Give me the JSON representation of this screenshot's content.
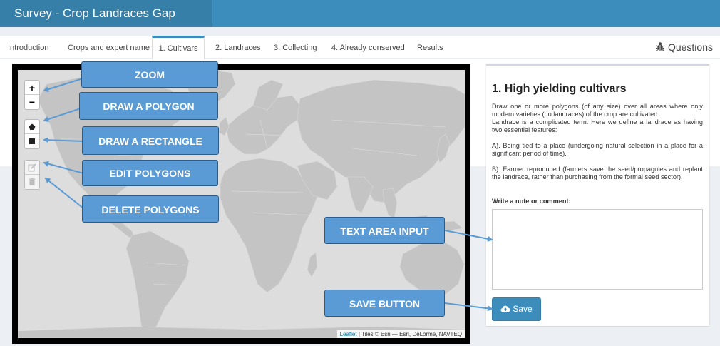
{
  "app": {
    "title": "Survey - Crop Landraces Gap Analysis"
  },
  "tabs": [
    {
      "label": "Introduction"
    },
    {
      "label": "Crops and expert name"
    },
    {
      "label": "1. Cultivars"
    },
    {
      "label": "2. Landraces"
    },
    {
      "label": "3. Collecting"
    },
    {
      "label": "4. Already conserved"
    },
    {
      "label": "Results"
    }
  ],
  "active_tab": "1. Cultivars",
  "questions": {
    "label": "Questions",
    "icon": "bug-icon"
  },
  "map": {
    "controls": {
      "zoom_in": "+",
      "zoom_out": "−",
      "draw_polygon_icon": "pentagon-icon",
      "draw_rectangle_icon": "square-icon",
      "edit_icon": "edit-icon",
      "delete_icon": "trash-icon"
    },
    "attribution_link": "Leaflet",
    "attribution_text": " | Tiles © Esri — Esri, DeLorme, NAVTEQ"
  },
  "callouts": {
    "zoom": "ZOOM",
    "draw_polygon": "DRAW A POLYGON",
    "draw_rectangle": "DRAW A RECTANGLE",
    "edit_polygons": "EDIT POLYGONS",
    "delete_polygons": "DELETE POLYGONS",
    "text_area": "TEXT AREA INPUT",
    "save_button": "SAVE BUTTON"
  },
  "panel": {
    "title": "1. High yielding cultivars",
    "intro": "Draw one or more polygons (of any size) over all areas where only modern varieties (no landraces) of the crop are cultivated.",
    "definition": "Landrace is a complicated term. Here we define a landrace as having two essential features:",
    "feature_a": "A). Being tied to a place (undergoing natural selection in a place for a significant period of time).",
    "feature_b": "B). Farmer reproduced (farmers save the seed/propagules and replant the landrace, rather than purchasing from the formal seed sector).",
    "note_label": "Write a note or comment:",
    "note_value": "",
    "save_label": "Save"
  },
  "colors": {
    "header": "#3c8dbc",
    "brand": "#367fa9",
    "callout_fill": "#5b9bd5",
    "callout_border": "#2e5c8a",
    "map_ocean": "#dddddd",
    "map_land": "#c4c4c4"
  }
}
